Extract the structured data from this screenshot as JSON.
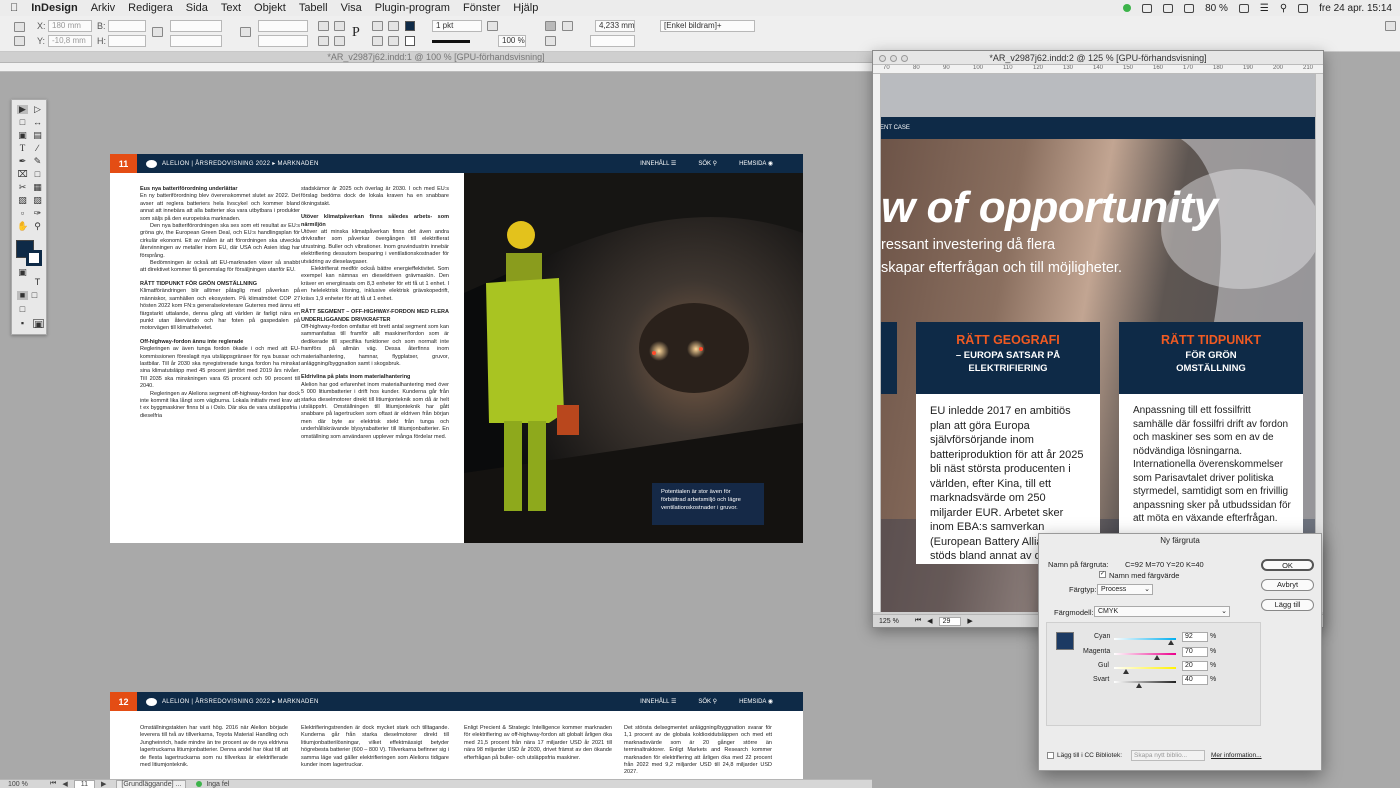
{
  "menubar": {
    "app": "InDesign",
    "items": [
      "Arkiv",
      "Redigera",
      "Sida",
      "Text",
      "Objekt",
      "Tabell",
      "Visa",
      "Plugin-program",
      "Fönster",
      "Hjälp"
    ],
    "battery": "80 %",
    "datetime": "fre 24 apr. 15:14"
  },
  "controlbar": {
    "x_label": "X:",
    "y_label": "Y:",
    "w_label": "B:",
    "h_label": "H:",
    "x_value": "180 mm",
    "y_value": "-10,8 mm",
    "stroke_weight": "1 pkt",
    "percent": "100 %",
    "dimension": "4,233 mm",
    "frame_style": "[Enkel bildram]+"
  },
  "window1": {
    "title": "*AR_v2987j62.indd:1 @ 100 % [GPU-förhandsvisning]"
  },
  "window2": {
    "title": "*AR_v2987j62.indd:2 @ 125 % [GPU-förhandsvisning]",
    "zoom": "125 %",
    "page": "29"
  },
  "ruler2": [
    "70",
    "80",
    "90",
    "100",
    "110",
    "120",
    "130",
    "140",
    "150",
    "160",
    "170",
    "180",
    "190",
    "200",
    "210"
  ],
  "spread1": {
    "page_number": "11",
    "crumb_main": "ALELION | ÅRSREDOVISNING 2022",
    "crumb_section": "MARKNADEN",
    "nav_contents": "INNEHÅLL",
    "nav_search": "SÖK",
    "nav_home": "HEMSIDA",
    "col1": [
      {
        "h": "Eus nya batteriförordning underlättar",
        "p": "En ny batteriförordning blev överenskommet slutet av 2022. Det avser att reglera batteriers hela livscykel och kommer bland annat att innebära att alla batterier ska vara utbytbara i produkter som säljs på den europeiska marknaden."
      },
      {
        "h": "",
        "p": "Den nya batteriförordningen ska ses som ett resultat av EU:s gröna giv, the European Green Deal, och EU:s handlingsplan för cirkulär ekonomi. Ett av målen är att förordningen ska utveckla återvinningen av metaller inom EU, där USA och Asien idag har försprång."
      },
      {
        "h": "",
        "p": "Bedömningen är också att EU-marknaden växer så snabbt att direktivet kommer få genomslag för försäljningen utanför EU."
      },
      {
        "h": "RÄTT TIDPUNKT FÖR GRÖN OMSTÄLLNING",
        "p": "Klimatförändringen blir alltmer påtaglig med påverkan på människor, samhällen och ekosystem. På klimatmötet COP 27 hösten 2022 kom FN:s generalsekreterare Guterres med ännu ett färgstarkt uttalande, denna gång att världen är farligt nära en punkt utan återvändo och har foten på gaspedalen på motorvägen till klimathelvetet."
      },
      {
        "h": "Off-highway-fordon ännu inte reglerade",
        "p": "Regleringen av även tunga fordon ökade i och med att EU-kommissionen föreslagit nya utsläppsgränser för nya bussar och lastbilar. Till år 2030 ska nyregistrerade tunga fordon ha minskat sina klimatutsläpp med 45 procent jämfört med 2019 års nivåer. Till 2035 ska minskningen vara 65 procent och 90 procent till 2040."
      },
      {
        "h": "",
        "p": "Regleringen av Alelions segment off-highway-fordon har dock inte kommit lika långt som vägburna. Lokala initiativ med krav att t ex byggmaskiner finns bl a i Oslo. Där ska de vara utsläppsfria i dieselfria"
      }
    ],
    "col2": [
      {
        "h": "",
        "p": "stadskärnor år 2025 och överlag år 2030. I och med EU:s förslag bedöms dock de lokala kraven ha en snabbare ökningstakt."
      },
      {
        "h": "Utöver klimatpåverkan finns således arbets- som närmiljön",
        "p": "Utöver att minska klimatpåverkan finns det även andra drivkrafter som påverkar övergången till elektrifierat utrustning. Buller och vibrationer. Inom gruvindustrin innebär elektrifiering dessutom besparing i ventilationskostnader för utvädring av dieselavgaser."
      },
      {
        "h": "",
        "p": "Elektrifierat medför också bättre energieffektivitet. Som exempel kan nämnas en dieseldriven grävmaskin. Den kräver en energiinsats om 8,3 enheter för ett få ut 1 enhet. I en helelektrisk lösning, inklusive elektrisk grävskopedrift, krävs 1,9 enheter för att få ut 1 enhet."
      },
      {
        "h": "RÄTT SEGMENT – OFF-HIGHWAY-FORDON MED FLERA UNDERLIGGANDE DRIVKRAFTER",
        "p": "Off-highway-fordon omfattar ett brett antal segment som kan sammanfattas till framför allt maskiner/fordon som är dedikerade till specifika funktioner och som normalt inte framförs på allmän väg. Dessa återfinns inom materialhantering, hamnar, flygplatser, gruvor, anläggning/byggnation samt i skogsbruk."
      },
      {
        "h": "Eldrivlina på plats inom materialhantering",
        "p": "Alelion har god erfarenhet inom materialhantering med över 5 000 litiumbatterier i drift hos kunder. Kunderna går från starka dieselmotorer direkt till litiumjonteknik som då är helt utsläppsfri. Omställningen till litiumjonteknik har gått snabbare på lagertrucken som oftast är eldriven från början men där byte av elektrisk stekt från tunga och underhållskrävande blysyrabatterier till litiumjonbatterier. En omställning som användaren upplever många fördelar med."
      }
    ],
    "caption": "Potentialen är stor även för förbättrad arbetsmiljö och lägre ventilationskostnader i gruvor."
  },
  "spread2": {
    "page_number": "12",
    "crumb_main": "ALELION | ÅRSREDOVISNING 2022",
    "crumb_section": "MARKNADEN",
    "cols": [
      "Omställningstakten har varit hög. 2016 när Alelion började leverera till två av tillverkarna, Toyota Material Handling och Jungheinrich, hade mindre än tre procent av de nya eldrivna lagertruckarna litiumjonbatterier. Denna andel har ökat till att de flesta lagertruckarna som nu tillverkas är elektrifierade med litiumjonteknik.",
      "Elektrifieringstrenden är dock mycket stark och tilltagande. Kunderna går från starka dieselmotorer direkt till litiumjonbatterilösningar, vilket effektmässigt betyder högrebesta batterier (600 – 800 V). Tillverkarna befinner sig i samma läge vad gäller elektrifieringen som Alelions tidigare kunder inom lagertruckar.",
      "Enligt Precient & Strategic Intelligence kommer marknaden för elektrifiering av off-highway-fordon att globalt årligen öka med 21,5 procent från nära 17 miljarder USD år 2021 till nära 98 miljarder USD år 2030, drivet främst av den ökande efterfrågan på buller- och utsläppsfria maskiner.",
      "Det största delsegmentet anläggning/byggnation svarar för 1,1 procent av de globala koldioxidutsläppen och med ett marknadsvärde som är 20 gånger större än terminaltraktorer. Enligt Markets and Research kommer marknaden för elektrifiering att årligen öka med 22 procent från 2022 med 9,2 miljarder USD till 24,8 miljarder USD 2027."
    ]
  },
  "win2page": {
    "tag": "CASE",
    "headline": "w of opportunity",
    "sub1": "ressant investering då flera",
    "sub2": "skapar efterfrågan och till  möjligheter.",
    "box1_title": "RÄTT GEOGRAFI",
    "box1_sub1": "– EUROPA SATSAR PÅ",
    "box1_sub2": "ELEKTRIFIERING",
    "box1_body": "EU inledde 2017 en ambitiös plan att göra Europa självförsörjande inom batteriproduktion för att år 2025 bli näst största producenten i världen, efter Kina, till ett marknadsvärde om 250 miljarder EUR. Arbetet sker inom EBA:s samverkan (European Battery Alliance) som stöds bland annat av det europeiska innovationsnavet för hållbar energi, EIT InnoEn",
    "box2_title": "RÄTT TIDPUNKT",
    "box2_sub1": "FÖR GRÖN",
    "box2_sub2": "OMSTÄLLNING",
    "box2_body": "Anpassning till ett fossilfritt samhälle där fossilfri drift av fordon och maskiner ses som en av de nödvändiga lösningarna. Internationella överenskommelser som Parisavtalet driver politiska styrmedel, samtidigt som en frivillig anpassning sker på utbudssidan för att möta en växande efterfrågan."
  },
  "dialog": {
    "title": "Ny färgruta",
    "name_label": "Namn på färgruta:",
    "name_value": "C=92 M=70 Y=20 K=40",
    "name_with_value": "Namn med färgvärde",
    "type_label": "Färgtyp:",
    "type_value": "Process",
    "model_label": "Färgmodell:",
    "model_value": "CMYK",
    "cyan_label": "Cyan",
    "cyan_value": "92",
    "magenta_label": "Magenta",
    "magenta_value": "70",
    "yellow_label": "Gul",
    "yellow_value": "20",
    "black_label": "Svart",
    "black_value": "40",
    "pct": "%",
    "ok": "OK",
    "cancel": "Avbryt",
    "add": "Lägg till",
    "cc_label": "Lägg till i CC Bibliotek:",
    "cc_placeholder": "Skapa nytt biblio...",
    "more_info": "Mer information...",
    "swatch_color": "#1c3a63"
  },
  "levels": {
    "cyan": 0.92,
    "magenta": 0.7,
    "yellow": 0.2,
    "black": 0.4
  },
  "statusbar": {
    "zoom": "100 %",
    "page": "11",
    "style": "[Grundläggande] ...",
    "errors": "Inga fel"
  }
}
